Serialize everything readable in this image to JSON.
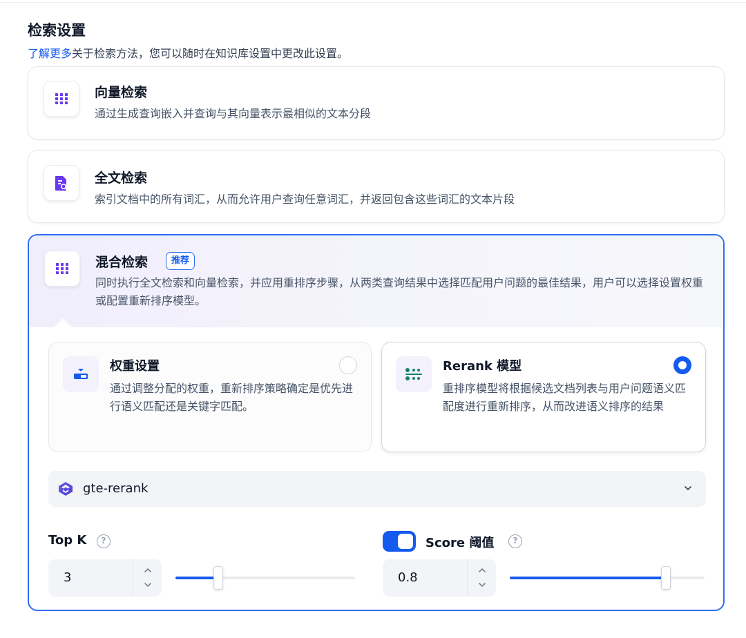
{
  "section": {
    "title": "检索设置",
    "desc_link": "了解更多",
    "desc_text": "关于检索方法，您可以随时在知识库设置中更改此设置。"
  },
  "methods": {
    "vector": {
      "title": "向量检索",
      "desc": "通过生成查询嵌入并查询与其向量表示最相似的文本分段",
      "icon": "grid-dots-icon"
    },
    "fulltext": {
      "title": "全文检索",
      "desc": "索引文档中的所有词汇，从而允许用户查询任意词汇，并返回包含这些词汇的文本片段",
      "icon": "document-search-icon"
    },
    "hybrid": {
      "title": "混合检索",
      "badge": "推荐",
      "desc": "同时执行全文检索和向量检索，并应用重排序步骤，从两类查询结果中选择匹配用户问题的最佳结果，用户可以选择设置权重或配置重新排序模型。",
      "icon": "grid-dots-icon",
      "selected": true
    }
  },
  "rerank_options": {
    "weight": {
      "title": "权重设置",
      "desc": "通过调整分配的权重，重新排序策略确定是优先进行语义匹配还是关键字匹配。",
      "selected": false,
      "icon": "balance-icon"
    },
    "rerank": {
      "title": "Rerank 模型",
      "desc": "重排序模型将根据候选文档列表与用户问题语义匹配度进行重新排序，从而改进语义排序的结果",
      "selected": true,
      "icon": "sort-dots-icon"
    }
  },
  "model": {
    "name": "gte-rerank",
    "icon": "qwen-logo-icon"
  },
  "top_k": {
    "label": "Top K",
    "value": "3",
    "slider_fraction": 0.24
  },
  "score_threshold": {
    "label": "Score 阈值",
    "enabled": true,
    "value": "0.8",
    "slider_fraction": 0.8
  },
  "colors": {
    "accent": "#155aef",
    "icon_purple": "#6938ef",
    "icon_green": "#15806b"
  }
}
